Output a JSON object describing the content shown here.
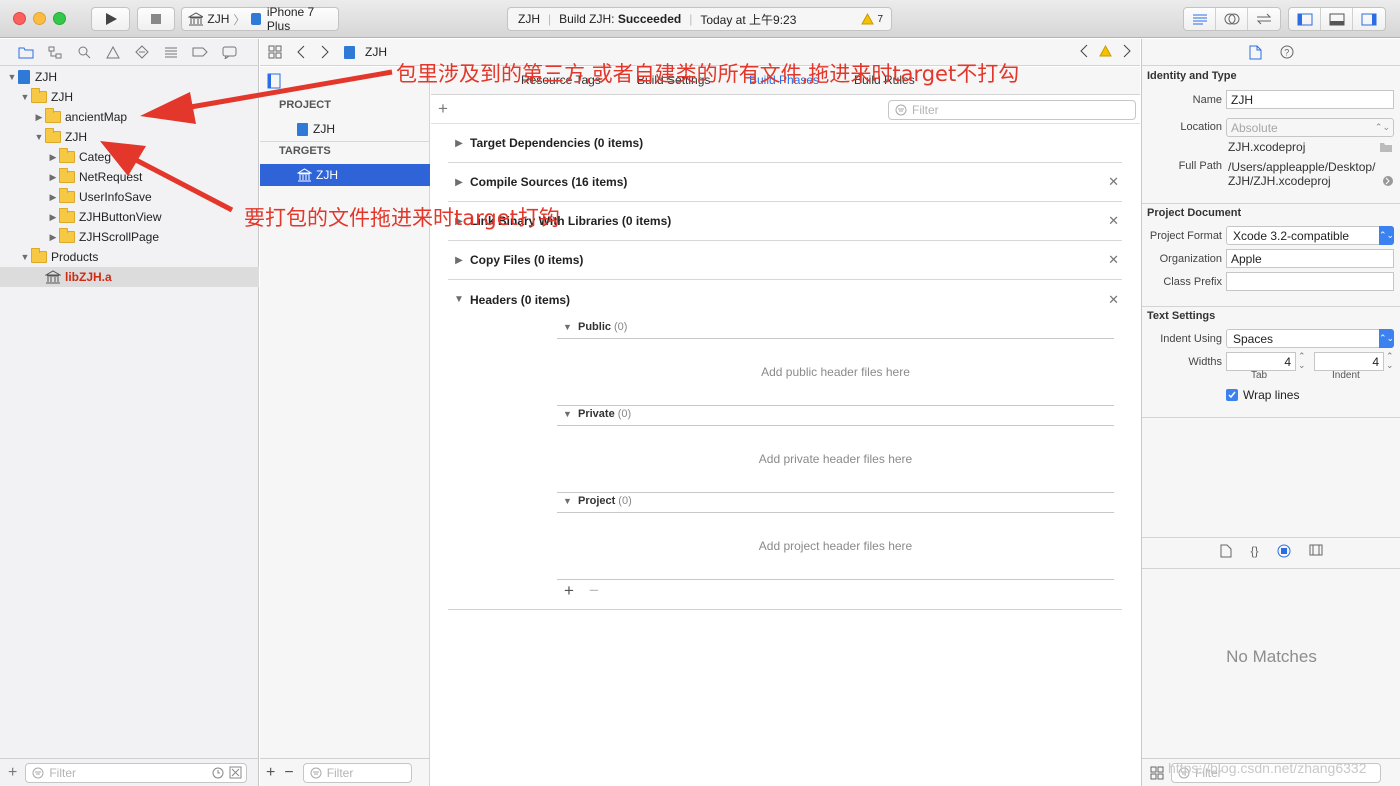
{
  "toolbar": {
    "scheme_target": "ZJH",
    "scheme_device": "iPhone 7 Plus",
    "activity_target": "ZJH",
    "activity_build_prefix": "Build ZJH:",
    "activity_build_status": "Succeeded",
    "activity_time": "Today at 上午9:23",
    "warning_count": "7"
  },
  "navigator": {
    "tree": [
      {
        "label": "ZJH",
        "type": "project"
      },
      {
        "label": "ZJH",
        "type": "folder"
      },
      {
        "label": "ancientMap",
        "type": "folder"
      },
      {
        "label": "ZJH",
        "type": "folder"
      },
      {
        "label": "Categ",
        "type": "folder"
      },
      {
        "label": "NetRequest",
        "type": "folder"
      },
      {
        "label": "UserInfoSave",
        "type": "folder"
      },
      {
        "label": "ZJHButtonView",
        "type": "folder"
      },
      {
        "label": "ZJHScrollPage",
        "type": "folder"
      },
      {
        "label": "Products",
        "type": "folder"
      },
      {
        "label": "libZJH.a",
        "type": "library"
      }
    ],
    "filter_placeholder": "Filter"
  },
  "jumpbar": {
    "crumb": "ZJH"
  },
  "project_list": {
    "project_header": "PROJECT",
    "project_item": "ZJH",
    "targets_header": "TARGETS",
    "target_item": "ZJH",
    "filter_placeholder": "Filter"
  },
  "tabs": [
    "Resource Tags",
    "Build Settings",
    "Build Phases",
    "Build Rules"
  ],
  "phases_filter_placeholder": "Filter",
  "phases": [
    {
      "label": "Target Dependencies (0 items)",
      "removable": false
    },
    {
      "label": "Compile Sources (16 items)",
      "removable": true
    },
    {
      "label": "Link Binary With Libraries (0 items)",
      "removable": true
    },
    {
      "label": "Copy Files (0 items)",
      "removable": true
    },
    {
      "label": "Headers (0 items)",
      "removable": true
    }
  ],
  "headers_sections": [
    {
      "label": "Public",
      "count": "(0)",
      "placeholder": "Add public header files here"
    },
    {
      "label": "Private",
      "count": "(0)",
      "placeholder": "Add private header files here"
    },
    {
      "label": "Project",
      "count": "(0)",
      "placeholder": "Add project header files here"
    }
  ],
  "inspector": {
    "identity_title": "Identity and Type",
    "name_label": "Name",
    "name_value": "ZJH",
    "location_label": "Location",
    "location_value": "Absolute",
    "file_name": "ZJH.xcodeproj",
    "full_path_label": "Full Path",
    "full_path_line1": "/Users/appleapple/Desktop/",
    "full_path_line2": "ZJH/ZJH.xcodeproj",
    "document_title": "Project Document",
    "format_label": "Project Format",
    "format_value": "Xcode 3.2-compatible",
    "org_label": "Organization",
    "org_value": "Apple",
    "prefix_label": "Class Prefix",
    "prefix_value": "",
    "text_title": "Text Settings",
    "indent_label": "Indent Using",
    "indent_value": "Spaces",
    "widths_label": "Widths",
    "tab_value": "4",
    "indent_width_value": "4",
    "tab_caption": "Tab",
    "indent_caption": "Indent",
    "wrap_label": "Wrap lines",
    "no_matches": "No Matches",
    "filter_placeholder": "Filter"
  },
  "annotations": {
    "top": "包里涉及到的第三方,或者自建类的所有文件,拖进来时target不打勾",
    "middle": "要打包的文件拖进来时target打钩"
  },
  "watermark": "https://blog.csdn.net/zhang6332",
  "colors": {
    "accent": "#2b6de4",
    "annotation": "#e2372a",
    "library": "#d12a14"
  }
}
